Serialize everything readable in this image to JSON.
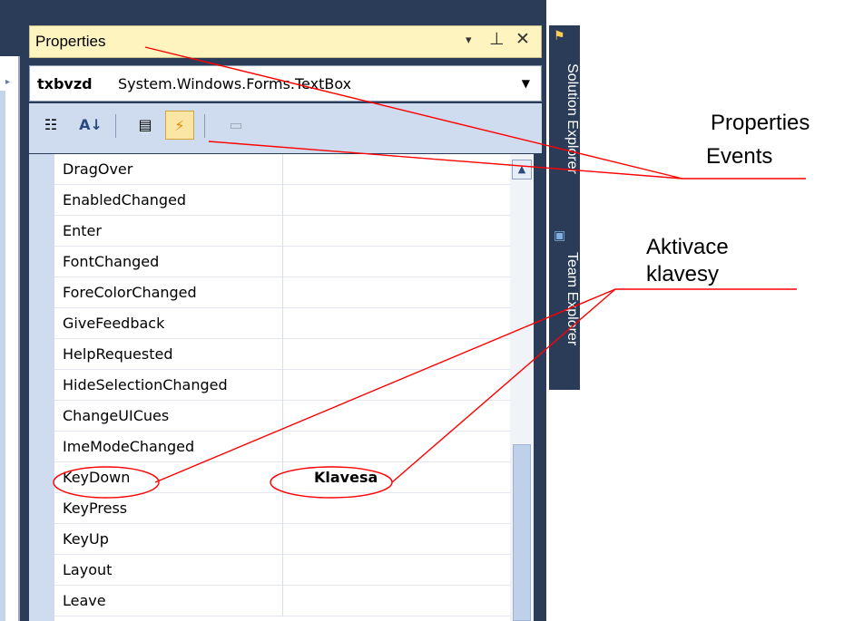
{
  "panel": {
    "title": "Properties",
    "controls": {
      "dropdown": "▾",
      "pin": "⊥",
      "close": "✕"
    }
  },
  "object_selector": {
    "name": "txbvzd",
    "type": "System.Windows.Forms.TextBox",
    "dropdown_icon": "▼"
  },
  "toolbar": {
    "buttons": [
      {
        "icon": "categorized-icon",
        "glyph": "☷"
      },
      {
        "icon": "alphabetical-icon",
        "glyph": "A↓"
      },
      {
        "icon": "properties-icon",
        "glyph": "▤"
      },
      {
        "icon": "events-icon",
        "glyph": "⚡"
      },
      {
        "icon": "property-pages-icon",
        "glyph": "▭"
      }
    ]
  },
  "events": [
    {
      "name": "DragOver",
      "value": ""
    },
    {
      "name": "EnabledChanged",
      "value": ""
    },
    {
      "name": "Enter",
      "value": ""
    },
    {
      "name": "FontChanged",
      "value": ""
    },
    {
      "name": "ForeColorChanged",
      "value": ""
    },
    {
      "name": "GiveFeedback",
      "value": ""
    },
    {
      "name": "HelpRequested",
      "value": ""
    },
    {
      "name": "HideSelectionChanged",
      "value": ""
    },
    {
      "name": "ChangeUICues",
      "value": ""
    },
    {
      "name": "ImeModeChanged",
      "value": ""
    },
    {
      "name": "KeyDown",
      "value": "Klavesa"
    },
    {
      "name": "KeyPress",
      "value": ""
    },
    {
      "name": "KeyUp",
      "value": ""
    },
    {
      "name": "Layout",
      "value": ""
    },
    {
      "name": "Leave",
      "value": ""
    }
  ],
  "side_tabs": {
    "solution_explorer": "Solution Explorer",
    "team_explorer": "Team Explorer"
  },
  "annotations": {
    "properties": "Properties",
    "events": "Events",
    "aktivace": "Aktivace",
    "klavesy": "klavesy"
  },
  "colors": {
    "annotation_line": "#ff0000",
    "title_bar": "#fdf4bf",
    "chrome": "#2b3c59"
  }
}
